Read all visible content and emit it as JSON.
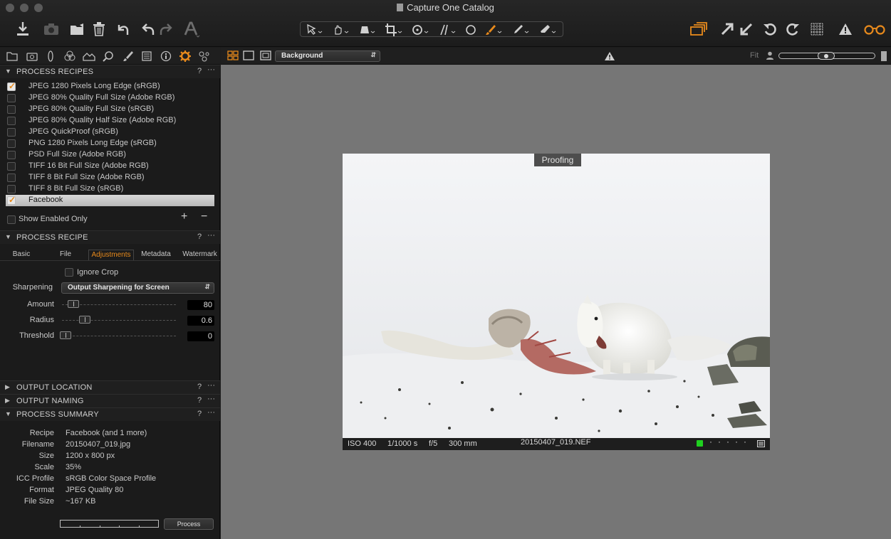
{
  "window": {
    "title": "Capture One Catalog"
  },
  "toolbar": {
    "left_icons": [
      "import-icon",
      "camera-icon",
      "move-folder-icon",
      "trash-icon",
      "undo-icon",
      "undo-alt-icon",
      "redo-icon",
      "text-icon"
    ],
    "cursor_tools": [
      "select-icon",
      "pan-icon",
      "keystone-icon",
      "crop-icon",
      "rotate-icon",
      "straighten-icon",
      "spot-icon",
      "brush-icon",
      "picker-icon",
      "eraser-icon"
    ],
    "right_icons": [
      "variants-icon",
      "export-icon",
      "import-arrow-icon",
      "rotate-left-icon",
      "rotate-right-icon",
      "grid-icon",
      "warning-icon",
      "glasses-icon"
    ]
  },
  "tool_tabs": [
    "folder-icon",
    "camera-icon",
    "lens-icon",
    "color-icon",
    "exposure-icon",
    "details-icon",
    "brush-icon",
    "metadata-icon",
    "info-icon",
    "output-icon",
    "batch-icon"
  ],
  "process_recipes": {
    "title": "PROCESS RECIPES",
    "help": "?",
    "more": "···",
    "items": [
      {
        "label": "JPEG 1280 Pixels Long Edge (sRGB)",
        "checked": true,
        "selected": false
      },
      {
        "label": "JPEG 80% Quality Full Size (Adobe RGB)",
        "checked": false,
        "selected": false
      },
      {
        "label": "JPEG 80% Quality Full Size (sRGB)",
        "checked": false,
        "selected": false
      },
      {
        "label": "JPEG 80% Quality Half Size (Adobe RGB)",
        "checked": false,
        "selected": false
      },
      {
        "label": "JPEG QuickProof (sRGB)",
        "checked": false,
        "selected": false
      },
      {
        "label": "PNG 1280 Pixels Long Edge (sRGB)",
        "checked": false,
        "selected": false
      },
      {
        "label": "PSD Full Size (Adobe RGB)",
        "checked": false,
        "selected": false
      },
      {
        "label": "TIFF 16 Bit Full Size (Adobe RGB)",
        "checked": false,
        "selected": false
      },
      {
        "label": "TIFF 8 Bit Full Size (Adobe RGB)",
        "checked": false,
        "selected": false
      },
      {
        "label": "TIFF 8 Bit Full Size (sRGB)",
        "checked": false,
        "selected": false
      },
      {
        "label": "Facebook",
        "checked": true,
        "selected": true
      }
    ],
    "show_enabled_only": "Show Enabled Only",
    "add": "+",
    "remove": "−"
  },
  "process_recipe": {
    "title": "PROCESS RECIPE",
    "tabs": [
      "Basic",
      "File",
      "Adjustments",
      "Metadata",
      "Watermark"
    ],
    "active_tab": "Adjustments",
    "ignore_crop": "Ignore Crop",
    "sharpening_label": "Sharpening",
    "sharpening_value": "Output Sharpening for Screen",
    "amount_label": "Amount",
    "amount_value": "80",
    "radius_label": "Radius",
    "radius_value": "0.6",
    "threshold_label": "Threshold",
    "threshold_value": "0"
  },
  "output_location": {
    "title": "OUTPUT LOCATION"
  },
  "output_naming": {
    "title": "OUTPUT NAMING"
  },
  "process_summary": {
    "title": "PROCESS SUMMARY",
    "rows": [
      {
        "label": "Recipe",
        "value": "Facebook (and 1 more)"
      },
      {
        "label": "Filename",
        "value": "20150407_019.jpg"
      },
      {
        "label": "Size",
        "value": "1200 x 800 px"
      },
      {
        "label": "Scale",
        "value": "35%"
      },
      {
        "label": "ICC Profile",
        "value": "sRGB Color Space Profile"
      },
      {
        "label": "Format",
        "value": "JPEG Quality 80"
      },
      {
        "label": "File Size",
        "value": "~167 KB"
      }
    ],
    "process_button": "Process"
  },
  "viewer": {
    "proofing_profile": "Background",
    "zoom_label": "Fit",
    "proofing_tag": "Proofing",
    "iso": "ISO 400",
    "shutter": "1/1000 s",
    "aperture": "f/5",
    "focal": "300 mm",
    "filename": "20150407_019.NEF",
    "status_color": "#1fd11f"
  },
  "colors": {
    "accent": "#e88a1c",
    "background": "#1b1b1b",
    "viewer_bg": "#767676"
  }
}
